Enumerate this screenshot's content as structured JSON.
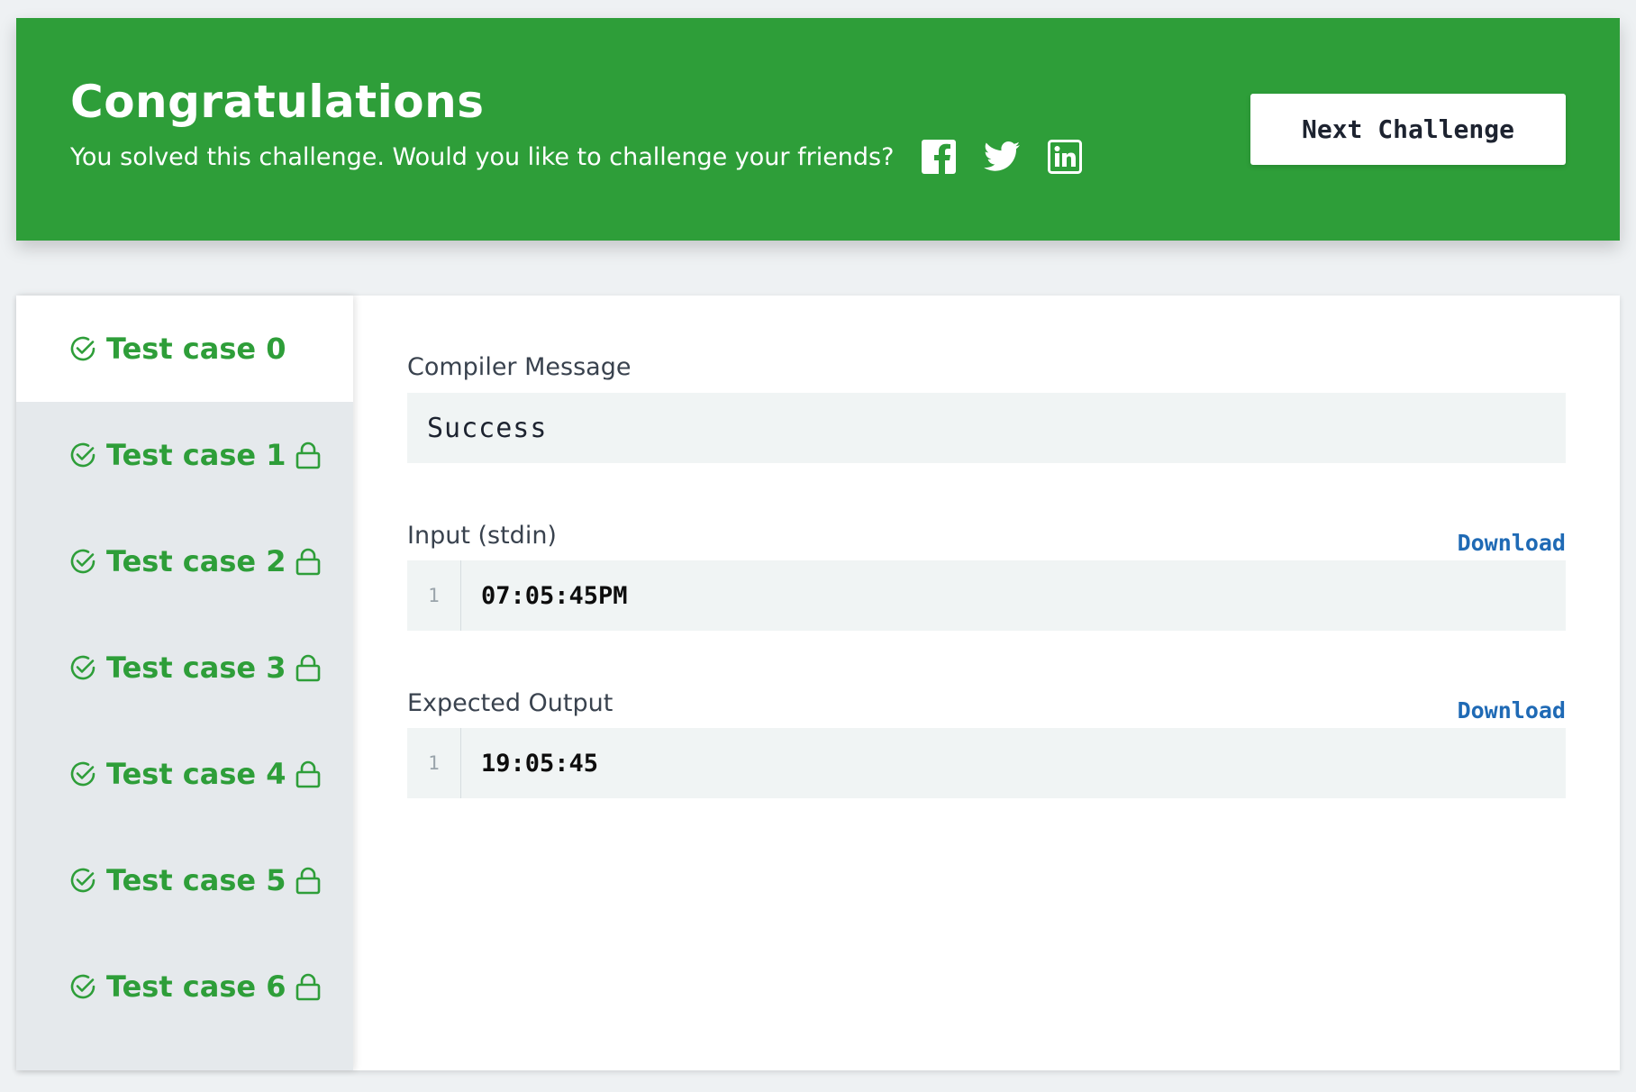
{
  "banner": {
    "title": "Congratulations",
    "subtitle": "You solved this challenge. Would you like to challenge your friends?",
    "social": [
      "facebook-icon",
      "twitter-icon",
      "linkedin-icon"
    ],
    "next_button": "Next Challenge",
    "background_color": "#2e9e39"
  },
  "tabs": [
    {
      "label": "Test case 0",
      "locked": false,
      "active": true
    },
    {
      "label": "Test case 1",
      "locked": true,
      "active": false
    },
    {
      "label": "Test case 2",
      "locked": true,
      "active": false
    },
    {
      "label": "Test case 3",
      "locked": true,
      "active": false
    },
    {
      "label": "Test case 4",
      "locked": true,
      "active": false
    },
    {
      "label": "Test case 5",
      "locked": true,
      "active": false
    },
    {
      "label": "Test case 6",
      "locked": true,
      "active": false
    }
  ],
  "panel": {
    "compiler_label": "Compiler Message",
    "compiler_message": "Success",
    "input_label": "Input (stdin)",
    "input_download": "Download",
    "input_line_number": "1",
    "input_value": "07:05:45PM",
    "expected_label": "Expected Output",
    "expected_download": "Download",
    "expected_line_number": "1",
    "expected_value": "19:05:45"
  },
  "colors": {
    "success_green": "#2e9e39",
    "link_blue": "#1f6ab5"
  }
}
